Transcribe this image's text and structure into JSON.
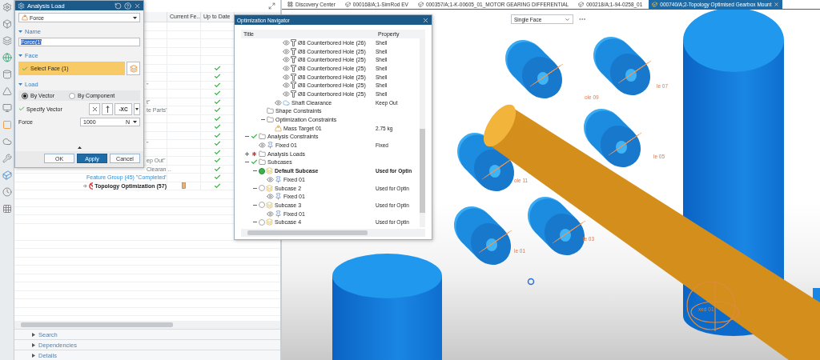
{
  "tabs": [
    {
      "label": "Discovery Center",
      "kind": "home",
      "selected": false
    },
    {
      "label": "000168/A;1-SimRod EV",
      "kind": "part",
      "selected": false
    },
    {
      "label": "000357/A;1-K-00605_01_MOTOR GEARING DIFFERENTIAL",
      "kind": "part",
      "selected": false
    },
    {
      "label": "000218/A;1-94-0258_01",
      "kind": "part",
      "selected": false
    },
    {
      "label": "000740/A;2-Topology Optimised Gearbox Mount",
      "kind": "part",
      "selected": true
    }
  ],
  "part_navigator": {
    "columns": [
      "Current Fe...",
      "Up to Date"
    ],
    "rows": [
      {
        "up_to_date": false,
        "current": false
      },
      {
        "up_to_date": false,
        "current": false
      },
      {
        "up_to_date": false,
        "current": false
      },
      {
        "up_to_date": false,
        "current": false
      },
      {
        "up_to_date": false,
        "current": false
      },
      {
        "up_to_date": true,
        "current": false
      },
      {
        "up_to_date": true,
        "current": false
      },
      {
        "text": "\"",
        "kind": "plain",
        "up_to_date": true,
        "current": false
      },
      {
        "up_to_date": true,
        "current": false
      },
      {
        "text": "t\"",
        "kind": "plain",
        "up_to_date": true,
        "current": false
      },
      {
        "text": "te Parts\"",
        "kind": "plain",
        "up_to_date": true,
        "current": false
      },
      {
        "up_to_date": true,
        "current": false
      },
      {
        "up_to_date": true,
        "current": false
      },
      {
        "up_to_date": true,
        "current": false
      },
      {
        "text": "\"",
        "kind": "plain",
        "up_to_date": true,
        "current": false
      },
      {
        "up_to_date": true,
        "current": false
      },
      {
        "text": "ep Out\"",
        "kind": "plain",
        "up_to_date": true,
        "current": false
      },
      {
        "text": "Clearan...",
        "kind": "plain",
        "up_to_date": true,
        "current": false
      },
      {
        "text": "Feature Group (45) \"Completed\"",
        "kind": "group",
        "up_to_date": true,
        "current": false
      },
      {
        "text": "Topology Optimization (57)",
        "kind": "optimization",
        "up_to_date": true,
        "current": true
      }
    ],
    "sections": [
      "Search",
      "Dependencies",
      "Details"
    ]
  },
  "analysis_load": {
    "title": "Analysis Load",
    "type": "Force",
    "name_section": "Name",
    "name_value": "Force(1)",
    "face_section": "Face",
    "select_face": "Select Face (1)",
    "face_done": true,
    "load_section": "Load",
    "options": [
      {
        "label": "By Vector",
        "selected": true
      },
      {
        "label": "By Component",
        "selected": false
      }
    ],
    "specify_vector": "Specify Vector",
    "vector_done": true,
    "vector_axis": "-XC",
    "force_label": "Force",
    "force_value": "1000",
    "force_unit": "N",
    "buttons": [
      {
        "label": "OK",
        "kind": "default"
      },
      {
        "label": "Apply",
        "kind": "primary"
      },
      {
        "label": "Cancel",
        "kind": "default"
      }
    ]
  },
  "optimization_navigator": {
    "title": "Optimization Navigator",
    "columns": [
      "Title",
      "Property"
    ],
    "tree": [
      {
        "children": [
          {
            "children": [
              {
                "children": [
                  {
                    "children": [
                      {
                        "title": "Ø8 Counterbored Hole (26)",
                        "property": "Shell",
                        "kind": "hole"
                      },
                      {
                        "title": "Ø8 Counterbored Hole (25)",
                        "property": "Shell",
                        "kind": "hole"
                      },
                      {
                        "title": "Ø8 Counterbored Hole (25)",
                        "property": "Shell",
                        "kind": "hole"
                      },
                      {
                        "title": "Ø8 Counterbored Hole (25)",
                        "property": "Shell",
                        "kind": "hole"
                      },
                      {
                        "title": "Ø8 Counterbored Hole (25)",
                        "property": "Shell",
                        "kind": "hole"
                      },
                      {
                        "title": "Ø8 Counterbored Hole (25)",
                        "property": "Shell",
                        "kind": "hole"
                      },
                      {
                        "title": "Ø8 Counterbored Hole (25)",
                        "property": "Shell",
                        "kind": "hole"
                      }
                    ]
                  },
                  {
                    "title": "Shaft Clearance",
                    "property": "Keep Out",
                    "kind": "keepout"
                  }
                ]
              },
              {
                "title": "Shape Constraints",
                "kind": "folder"
              },
              {
                "title": "Optimization Constraints",
                "kind": "folder",
                "expanded": true,
                "children": [
                  {
                    "title": "Mass Target 01",
                    "property": "2.75 kg",
                    "kind": "mass"
                  }
                ]
              }
            ]
          }
        ]
      },
      {
        "title": "Analysis Constraints",
        "kind": "folder",
        "ok": true,
        "expanded": true,
        "children": [
          {
            "title": "Fixed 01",
            "property": "Fixed",
            "kind": "fixed"
          }
        ]
      },
      {
        "title": "Analysis Loads",
        "kind": "folder",
        "ok": false,
        "expanded": false
      },
      {
        "title": "Subcases",
        "kind": "folder",
        "ok": true,
        "expanded": true,
        "children": [
          {
            "title": "Default Subcase",
            "property": "Used for Optin",
            "kind": "subcase",
            "selected": true,
            "expanded": true,
            "children": [
              {
                "title": "Fixed 01",
                "kind": "fixed"
              }
            ]
          },
          {
            "title": "Subcase 2",
            "property": "Used for Optin",
            "kind": "subcase",
            "selected": false,
            "expanded": true,
            "children": [
              {
                "title": "Fixed 01",
                "kind": "fixed"
              }
            ]
          },
          {
            "title": "Subcase 3",
            "property": "Used for Optin",
            "kind": "subcase",
            "selected": false,
            "expanded": true,
            "children": [
              {
                "title": "Fixed 01",
                "kind": "fixed"
              }
            ]
          },
          {
            "title": "Subcase 4",
            "property": "Used for Optin",
            "kind": "subcase",
            "selected": false,
            "expanded": true
          }
        ]
      }
    ]
  },
  "viewport": {
    "selection_filter": "Single Face",
    "labels": [
      {
        "text": "ole 09",
        "kind": "hole"
      },
      {
        "text": "le 07",
        "kind": "hole"
      },
      {
        "text": "le 05",
        "kind": "hole"
      },
      {
        "text": "ole 11",
        "kind": "hole"
      },
      {
        "text": "le 03",
        "kind": "hole"
      },
      {
        "text": "le 01",
        "kind": "hole"
      },
      {
        "text": "xed 01",
        "kind": "fixed"
      }
    ]
  }
}
